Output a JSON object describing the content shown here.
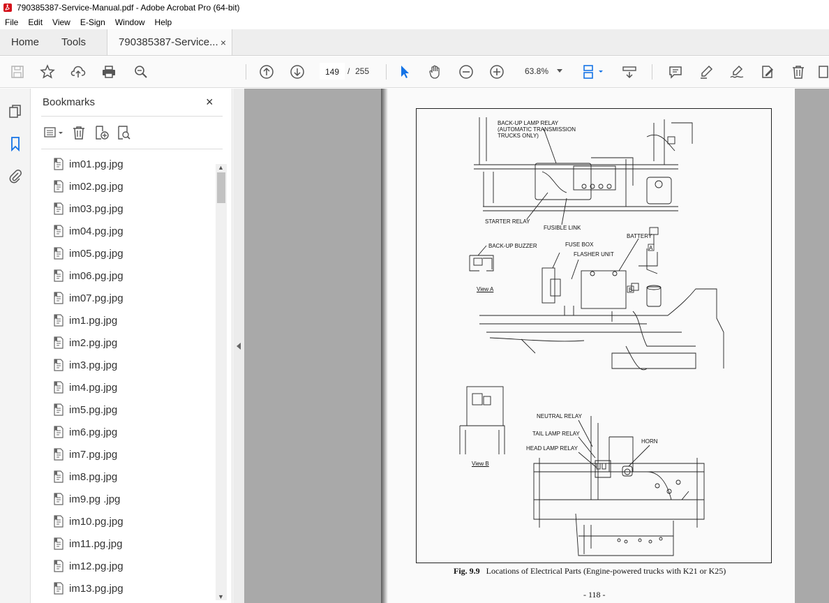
{
  "window": {
    "title": "790385387-Service-Manual.pdf - Adobe Acrobat Pro (64-bit)"
  },
  "menu": [
    "File",
    "Edit",
    "View",
    "E-Sign",
    "Window",
    "Help"
  ],
  "tabs": {
    "home": "Home",
    "tools": "Tools",
    "document": "790385387-Service...",
    "close_symbol": "×"
  },
  "toolbar": {
    "current_page": "149",
    "page_separator": "/",
    "total_pages": "255",
    "zoom": "63.8%"
  },
  "bookmarks": {
    "title": "Bookmarks",
    "close_symbol": "×",
    "items": [
      "im01.pg.jpg",
      "im02.pg.jpg",
      "im03.pg.jpg",
      "im04.pg.jpg",
      "im05.pg.jpg",
      "im06.pg.jpg",
      "im07.pg.jpg",
      "im1.pg.jpg",
      "im2.pg.jpg",
      "im3.pg.jpg",
      "im4.pg.jpg",
      "im5.pg.jpg",
      "im6.pg.jpg",
      "im7.pg.jpg",
      "im8.pg.jpg",
      "im9.pg .jpg",
      "im10.pg.jpg",
      "im11.pg.jpg",
      "im12.pg.jpg",
      "im13.pg.jpg"
    ]
  },
  "document": {
    "figure_number": "Fig. 9.9",
    "caption": "Locations of Electrical Parts (Engine-powered trucks with K21 or K25)",
    "page_number": "- 118 -",
    "labels": {
      "backup_lamp_relay": "BACK-UP LAMP RELAY\n(AUTOMATIC TRANSMISSION\nTRUCKS ONLY)",
      "starter_relay": "STARTER RELAY",
      "fusible_link": "FUSIBLE LINK",
      "battery": "BATTERY",
      "backup_buzzer": "BACK-UP BUZZER",
      "fuse_box": "FUSE BOX",
      "flasher_unit": "FLASHER UNIT",
      "view_a": "View A",
      "view_b": "View B",
      "marker_a": "A",
      "marker_b": "B",
      "neutral_relay": "NEUTRAL RELAY",
      "tail_lamp_relay": "TAIL LAMP RELAY",
      "head_lamp_relay": "HEAD LAMP RELAY",
      "horn": "HORN"
    }
  },
  "colors": {
    "acrobat_red": "#d4101a",
    "selected_tool": "#1473e6",
    "doc_background": "#a9a9a9"
  },
  "icons": {
    "toolbar": [
      "save-icon",
      "star-icon",
      "upload-icon",
      "print-icon",
      "zoom-search-icon",
      "prev-page-icon",
      "next-page-icon",
      "select-arrow-icon",
      "hand-icon",
      "zoom-out-icon",
      "zoom-in-icon",
      "page-fit-icon",
      "scroll-mode-icon",
      "comment-icon",
      "highlight-icon",
      "sign-icon",
      "edit-icon",
      "delete-icon",
      "more-icon"
    ],
    "rail": [
      "pages-icon",
      "bookmark-icon",
      "attachment-icon"
    ],
    "bookmark_tools": [
      "options-icon",
      "delete-bookmark-icon",
      "new-bookmark-icon",
      "find-bookmark-icon"
    ]
  }
}
